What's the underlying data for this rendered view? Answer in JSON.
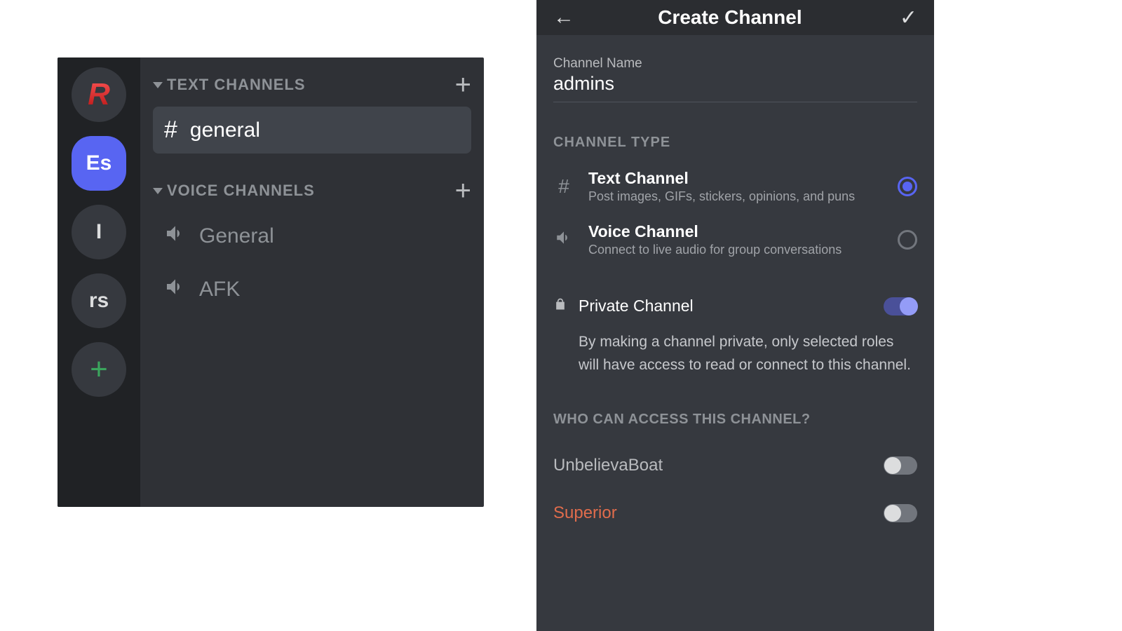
{
  "left": {
    "servers": [
      "R",
      "Es",
      "I",
      "rs"
    ],
    "categories": {
      "text": {
        "label": "TEXT CHANNELS"
      },
      "voice": {
        "label": "VOICE CHANNELS"
      }
    },
    "text_channels": [
      {
        "name": "general"
      }
    ],
    "voice_channels": [
      {
        "name": "General"
      },
      {
        "name": "AFK"
      }
    ]
  },
  "right": {
    "title": "Create Channel",
    "field": {
      "label": "Channel Name",
      "value": "admins"
    },
    "type_section": "CHANNEL TYPE",
    "types": {
      "text": {
        "title": "Text Channel",
        "sub": "Post images, GIFs, stickers, opinions, and puns"
      },
      "voice": {
        "title": "Voice Channel",
        "sub": "Connect to live audio for group conversations"
      }
    },
    "private": {
      "label": "Private Channel",
      "desc": "By making a channel private, only selected roles will have access to read or connect to this channel."
    },
    "access_section": "WHO CAN ACCESS THIS CHANNEL?",
    "roles": [
      {
        "name": "UnbelievaBoat",
        "color": "default"
      },
      {
        "name": "Superior",
        "color": "superior"
      }
    ]
  }
}
